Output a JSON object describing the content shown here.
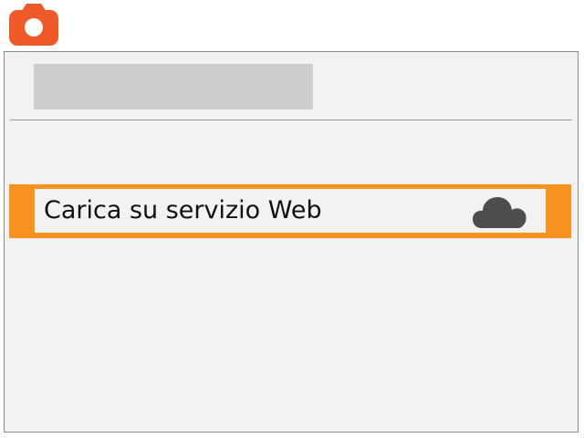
{
  "header": {
    "icon": "camera-icon",
    "icon_color": "#f05a28"
  },
  "menu": {
    "items": [
      {
        "label": "Carica su servizio Web",
        "icon": "cloud-icon",
        "selected": true
      }
    ],
    "highlight_color": "#f7931e"
  }
}
